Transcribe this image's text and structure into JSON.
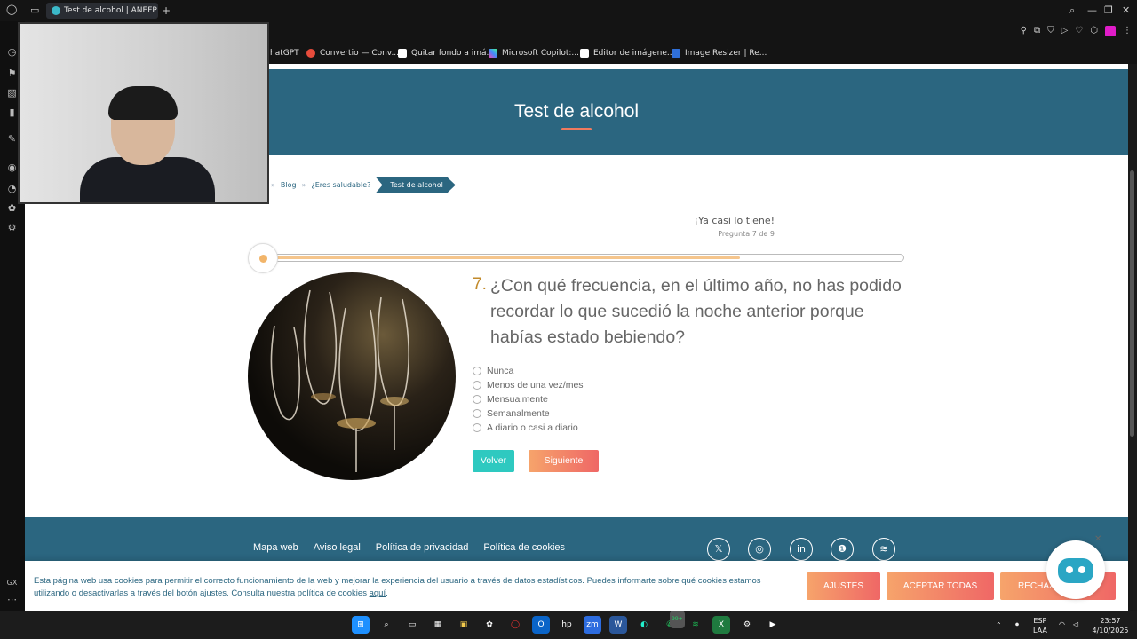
{
  "browser": {
    "tab_title": "Test de alcohol | ANEFP",
    "new_tab": "+",
    "bookmarks": [
      {
        "label": "hatGPT",
        "color": "#141414"
      },
      {
        "label": "Convertio — Conv...",
        "color": "#e74c3c"
      },
      {
        "label": "Quitar fondo a imá...",
        "color": "#ffffff"
      },
      {
        "label": "Microsoft Copilot:...",
        "color": "#7b5cf0"
      },
      {
        "label": "Editor de imágene...",
        "color": "#ffffff"
      },
      {
        "label": "Image Resizer | Re...",
        "color": "#2f6fd8"
      }
    ],
    "sidebar_label": "GX"
  },
  "hero": {
    "title": "Test de alcohol"
  },
  "breadcrumb": {
    "items": [
      "Blog",
      "¿Eres saludable?"
    ],
    "active": "Test de alcohol",
    "separator": "»"
  },
  "progress": {
    "heading": "¡Ya casi lo tiene!",
    "subtitle": "Pregunta 7 de 9",
    "fraction": 0.75
  },
  "question": {
    "number": "7.",
    "text": "¿Con qué frecuencia, en el último año, no has podido recordar lo que sucedió la noche anterior porque habías estado bebiendo?",
    "options": [
      "Nunca",
      "Menos de una vez/mes",
      "Mensualmente",
      "Semanalmente",
      "A diario o casi a diario"
    ]
  },
  "buttons": {
    "back": "Volver",
    "next": "Siguiente"
  },
  "footer": {
    "links": [
      "Mapa web",
      "Aviso legal",
      "Política de privacidad",
      "Política de cookies"
    ],
    "social": [
      "𝕏",
      "◎",
      "in",
      "❶",
      "≋"
    ]
  },
  "cookie": {
    "text": "Esta página web usa cookies para permitir el correcto funcionamiento de la web y mejorar la experiencia del usuario a través de datos estadísticos. Puedes informarte sobre qué cookies estamos utilizando o desactivarlas a través del botón ajustes. Consulta nuestra política de cookies",
    "link": "aquí",
    "settings": "AJUSTES",
    "accept_all": "ACEPTAR TODAS",
    "reject": "RECHAZ"
  },
  "taskbar": {
    "lang": "ESP",
    "lang2": "LAA",
    "time": "23:57",
    "date": "4/10/2025",
    "badge": "99+"
  }
}
